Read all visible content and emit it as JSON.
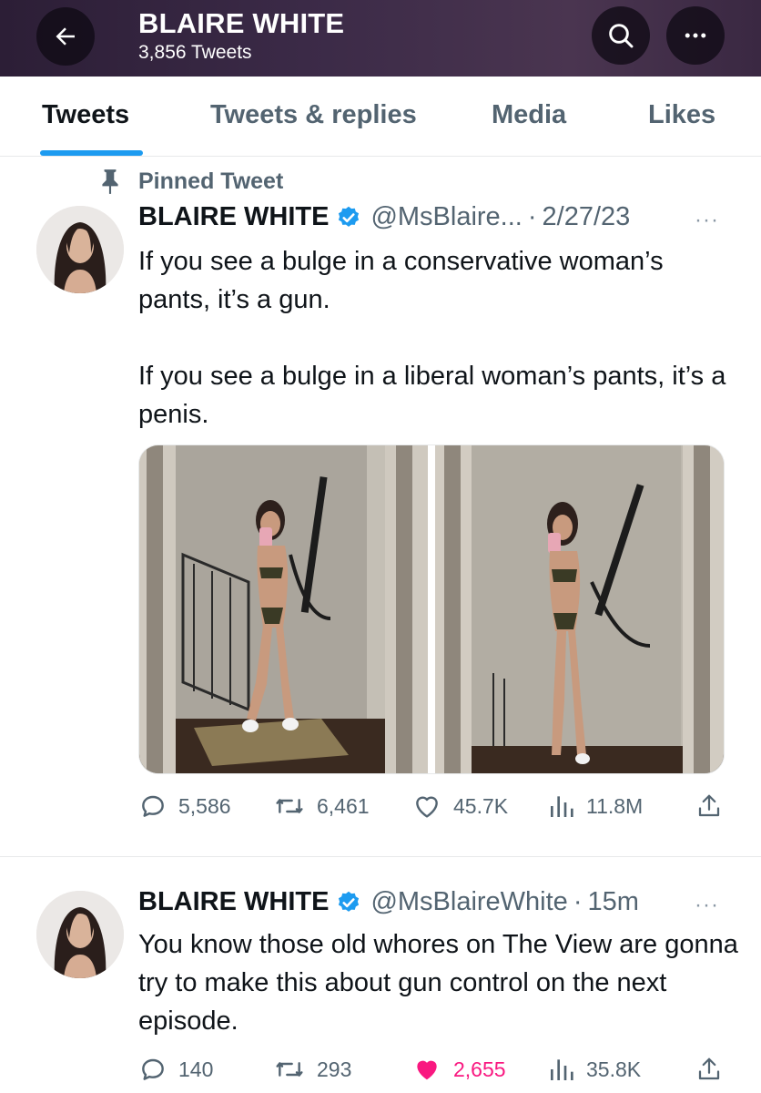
{
  "header": {
    "title": "BLAIRE WHITE",
    "subtitle": "3,856 Tweets",
    "back_icon": "arrow-left-icon",
    "search_icon": "search-icon",
    "more_icon": "more-icon",
    "background": "#3b2a47"
  },
  "tabs": [
    {
      "label": "Tweets",
      "active": true
    },
    {
      "label": "Tweets & replies",
      "active": false
    },
    {
      "label": "Media",
      "active": false
    },
    {
      "label": "Likes",
      "active": false
    }
  ],
  "colors": {
    "accent": "#1d9bf0",
    "like": "#f91880",
    "muted": "#536471"
  },
  "tweets": [
    {
      "pinned_label": "Pinned Tweet",
      "author": "BLAIRE WHITE",
      "handle": "@MsBlaire...",
      "dot": "·",
      "time": "2/27/23",
      "more": "···",
      "text": "If you see a bulge in a conservative woman’s pants, it’s a gun.\n\nIf you see a bulge in a liberal woman’s pants, it’s a penis.",
      "media_count": 2,
      "stats": {
        "replies": "5,586",
        "retweets": "6,461",
        "likes": "45.7K",
        "views": "11.8M"
      },
      "liked": false
    },
    {
      "author": "BLAIRE WHITE",
      "handle": "@MsBlaireWhite",
      "dot": "·",
      "time": "15m",
      "more": "···",
      "text": "You know those old whores on The View are gonna try to make this about gun control on the next episode.",
      "stats": {
        "replies": "140",
        "retweets": "293",
        "likes": "2,655",
        "views": "35.8K"
      },
      "liked": true
    }
  ]
}
